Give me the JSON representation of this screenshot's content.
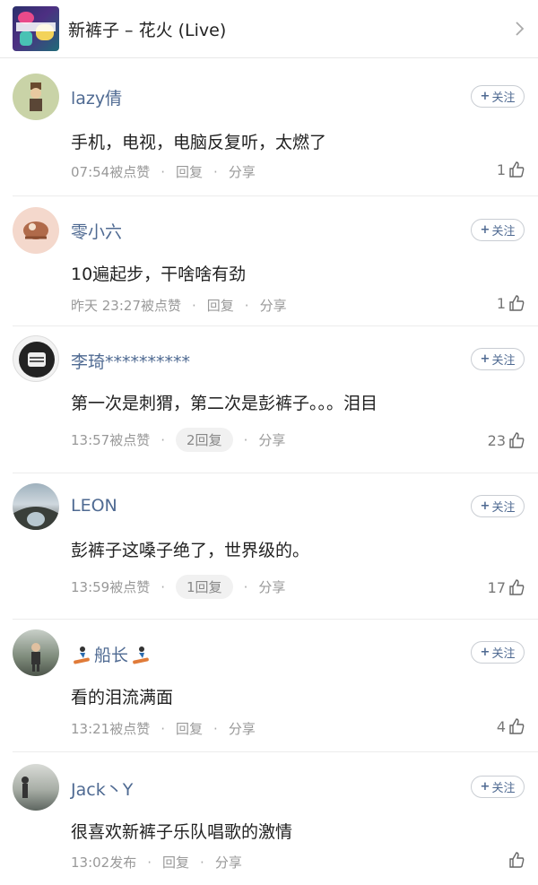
{
  "header": {
    "title": "新裤子 – 花火 (Live)"
  },
  "follow_label": "关注",
  "comments": [
    {
      "user": "lazy倩",
      "text": "手机，电视，电脑反复听，太燃了",
      "time": "07:54被点赞",
      "reply": "回复",
      "share": "分享",
      "likes": "1"
    },
    {
      "user": "零小六",
      "text": "10遍起步，干啥啥有劲",
      "time": "昨天 23:27被点赞",
      "reply": "回复",
      "share": "分享",
      "likes": "1"
    },
    {
      "user": "李琦**********",
      "text": "第一次是刺猬，第二次是彭裤子。。。泪目",
      "time": "13:57被点赞",
      "reply": "2回复",
      "share": "分享",
      "likes": "23"
    },
    {
      "user": "LEON",
      "text": "彭裤子这嗓子绝了，世界级的。",
      "time": "13:59被点赞",
      "reply": "1回复",
      "share": "分享",
      "likes": "17"
    },
    {
      "user": "船长",
      "text": "看的泪流满面",
      "time": "13:21被点赞",
      "reply": "回复",
      "share": "分享",
      "likes": "4"
    },
    {
      "user": "Jack丶Y",
      "text": "很喜欢新裤子乐队唱歌的激情",
      "time": "13:02发布",
      "reply": "回复",
      "share": "分享",
      "likes": ""
    }
  ]
}
